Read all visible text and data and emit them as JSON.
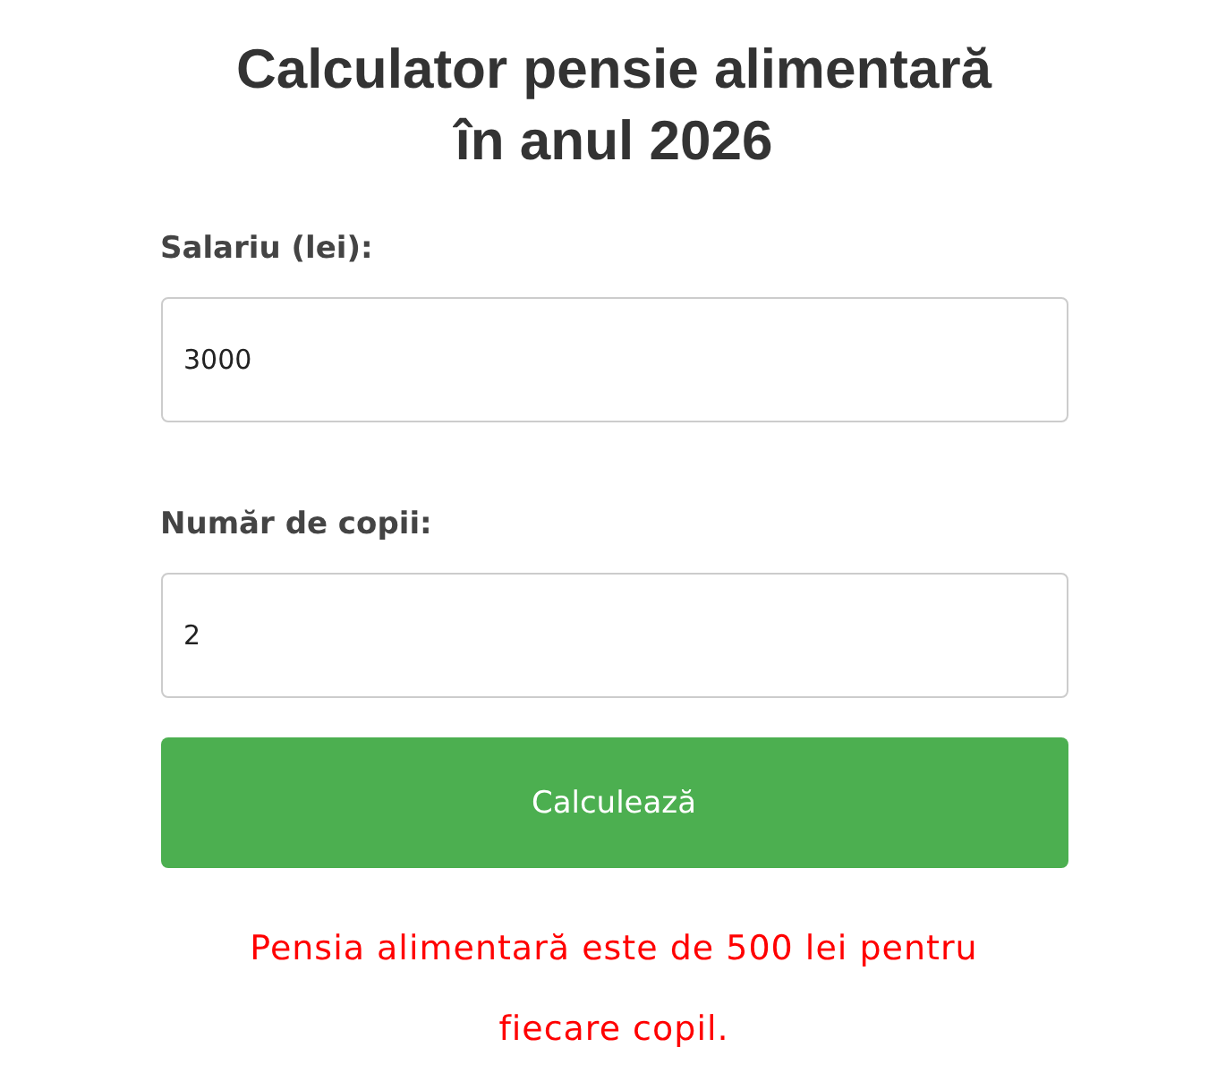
{
  "title": "Calculator pensie alimentară în anul 2026",
  "fields": [
    {
      "label": "Salariu (lei):",
      "value": "3000"
    },
    {
      "label": "Număr de copii:",
      "value": "2"
    }
  ],
  "button": {
    "label": "Calculează"
  },
  "result": "Pensia alimentară este de 500 lei pentru fiecare copil."
}
